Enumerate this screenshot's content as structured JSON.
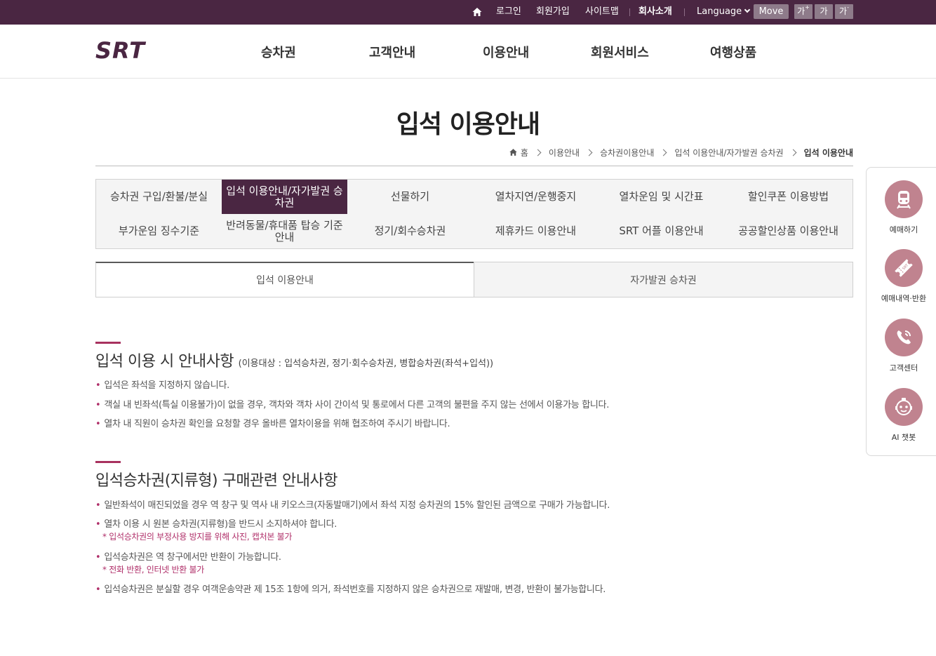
{
  "topbar": {
    "login": "로그인",
    "join": "회원가입",
    "sitemap": "사이트맵",
    "company": "회사소개",
    "language": "Language",
    "move": "Move",
    "font_up": "가",
    "font_up_sup": "+",
    "font_normal": "가",
    "font_down": "가",
    "font_down_sup": "-"
  },
  "logo_text": "SRT",
  "gnb": [
    "승차권",
    "고객안내",
    "이용안내",
    "회원서비스",
    "여행상품"
  ],
  "page_title": "입석 이용안내",
  "breadcrumb": [
    "홈",
    "이용안내",
    "승차권이용안내",
    "입석 이용안내/자가발권 승차권",
    "입석 이용안내"
  ],
  "submenu": [
    "승차권 구입/환불/분실",
    "입석 이용안내/자가발권 승차권",
    "선물하기",
    "열차지연/운행중지",
    "열차운임 및 시간표",
    "할인쿠폰 이용방법",
    "부가운임 징수기준",
    "반려동물/휴대품 탑승 기준 안내",
    "정기/회수승차권",
    "제휴카드 이용안내",
    "SRT 어플 이용안내",
    "공공할인상품 이용안내"
  ],
  "tabs": [
    "입석 이용안내",
    "자가발권 승차권"
  ],
  "section1": {
    "title": "입석 이용 시 안내사항",
    "subtitle": "(이용대상 : 입석승차권, 정기·회수승차권, 병합승차권(좌석+입석))",
    "items": [
      "입석은 좌석을 지정하지 않습니다.",
      "객실 내 빈좌석(특실 이용불가)이 없을 경우, 객차와 객차 사이 간이석 및 통로에서 다른 고객의 불편을 주지 않는 선에서 이용가능 합니다.",
      "열차 내 직원이 승차권 확인을 요청할 경우 올바른 열차이용을 위해 협조하여 주시기 바랍니다."
    ]
  },
  "section2": {
    "title": "입석승차권(지류형) 구매관련 안내사항",
    "items": [
      "일반좌석이 매진되었을 경우 역 창구 및 역사 내 키오스크(자동발매기)에서 좌석 지정 승차권의 15% 할인된 금액으로 구매가 가능합니다.",
      "열차 이용 시 원본 승차권(지류형)을 반드시 소지하셔야 합니다.",
      "입석승차권은 역 창구에서만 반환이 가능합니다.",
      "입석승차권은 분실할 경우 여객운송약관 제 15조 1항에 의거, 좌석번호를 지정하지 않은 승차권으로 재발매, 변경, 반환이 불가능합니다."
    ],
    "notes": [
      "* 입석승차권의 부정사용 방지를 위해 사진, 캡처본 불가",
      "* 전화 반환, 인터넷 반환 불가"
    ]
  },
  "quick_menu": [
    {
      "label": "예매하기",
      "icon": "train-icon"
    },
    {
      "label": "예매내역·반환",
      "icon": "ticket-icon"
    },
    {
      "label": "고객센터",
      "icon": "phone-icon"
    },
    {
      "label": "AI 챗봇",
      "icon": "chatbot-icon"
    }
  ],
  "colors": {
    "brand": "#4a2642",
    "accent": "#b0306a",
    "quick_circle": "#c0838f"
  }
}
